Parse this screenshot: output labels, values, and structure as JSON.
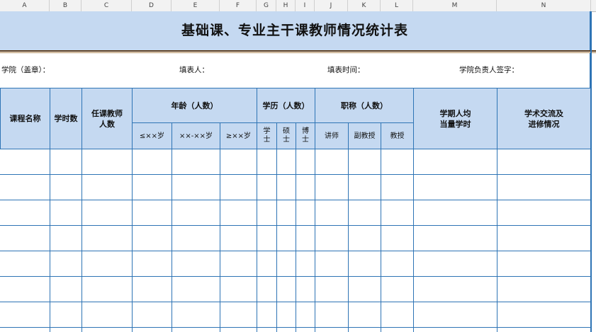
{
  "col_headers": [
    "A",
    "B",
    "C",
    "D",
    "E",
    "F",
    "G",
    "H",
    "I",
    "J",
    "K",
    "L",
    "M",
    "N"
  ],
  "title": "基础课、专业主干课教师情况统计表",
  "info": {
    "college_seal": "学院（盖章）：",
    "filler": "填表人：",
    "fill_time": "填表时间：",
    "dean_sign": "学院负责人签字："
  },
  "table": {
    "course_name": "课程名称",
    "hours": "学时数",
    "teachers": "任课教师\n人数",
    "age_group": "年龄（人数）",
    "age_sub": [
      "≤××岁",
      "××-××岁",
      "≥××岁"
    ],
    "degree_group": "学历（人数）",
    "degree_sub": [
      "学\n士",
      "硕\n士",
      "博\n士"
    ],
    "title_group": "职称（人数）",
    "title_sub": [
      "讲师",
      "副教授",
      "教授"
    ],
    "avg_hours": "学期人均\n当量学时",
    "exchange": "学术交流及\n进修情况"
  }
}
